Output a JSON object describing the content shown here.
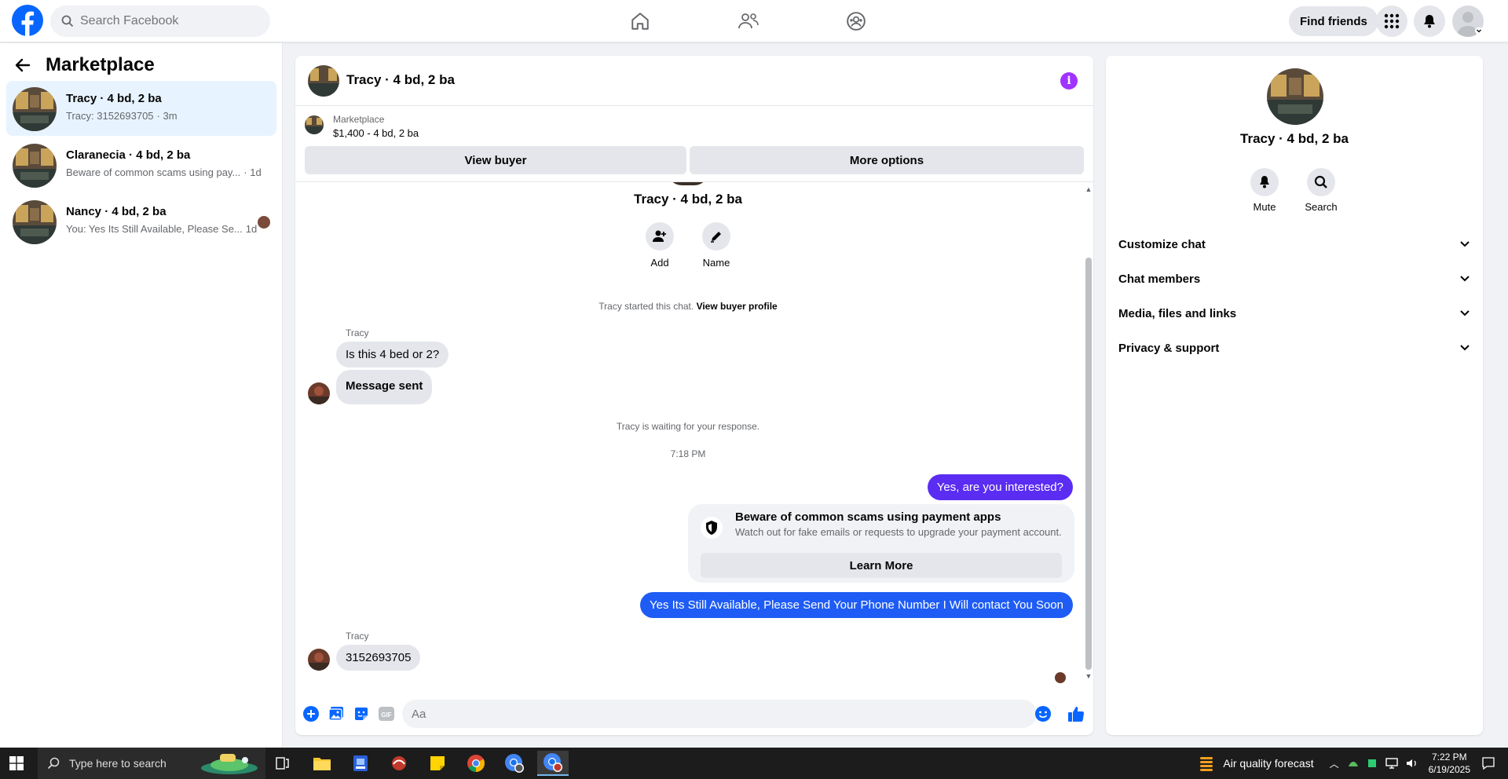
{
  "topbar": {
    "search_placeholder": "Search Facebook",
    "find_friends": "Find friends",
    "nav_icons": [
      "home-icon",
      "friends-icon",
      "groups-icon"
    ],
    "right_icons": [
      "menu-grid-icon",
      "bell-icon",
      "account-icon"
    ]
  },
  "sidebar": {
    "title": "Marketplace",
    "conversations": [
      {
        "title": "Tracy · 4 bd, 2 ba",
        "preview": "Tracy: 3152693705",
        "time": "· 3m",
        "active": true
      },
      {
        "title": "Claranecia · 4 bd, 2 ba",
        "preview": "Beware of common scams using pay...",
        "time": "· 1d",
        "active": false
      },
      {
        "title": "Nancy · 4 bd, 2 ba",
        "preview": "You: Yes Its Still Available, Please Se...",
        "time": "1d",
        "active": false
      }
    ]
  },
  "chat": {
    "title": "Tracy · 4 bd, 2 ba",
    "listing_source": "Marketplace",
    "listing_price": "$1,400 - 4 bd, 2 ba",
    "view_buyer": "View buyer",
    "more_options": "More options",
    "profile_name": "Tracy · 4 bd, 2 ba",
    "add_label": "Add",
    "name_label": "Name",
    "started_text": "Tracy started this chat.",
    "view_buyer_profile": "View buyer profile",
    "sender_1": "Tracy",
    "msg_in_1": "Is this 4 bed or 2?",
    "msg_in_2": "Message sent",
    "waiting_text": "Tracy is waiting for your response.",
    "timestamp": "7:18 PM",
    "msg_out_1": "Yes, are you interested?",
    "warning_title": "Beware of common scams using payment apps",
    "warning_sub": "Watch out for fake emails or requests to upgrade your payment account.",
    "learn_more": "Learn More",
    "msg_out_2": "Yes Its Still Available, Please Send Your Phone Number I Will contact You Soon",
    "sender_2": "Tracy",
    "msg_in_3": "3152693705",
    "composer_placeholder": "Aa",
    "accent_color": "#0866ff",
    "out_color_1": "#5b2cf2",
    "out_color_2": "#1e5cf5"
  },
  "right_panel": {
    "name": "Tracy · 4 bd, 2 ba",
    "mute": "Mute",
    "search": "Search",
    "sections": [
      "Customize chat",
      "Chat members",
      "Media, files and links",
      "Privacy & support"
    ]
  },
  "taskbar": {
    "search_placeholder": "Type here to search",
    "weather": "Air quality forecast",
    "time": "7:22 PM",
    "date": "6/19/2025"
  }
}
